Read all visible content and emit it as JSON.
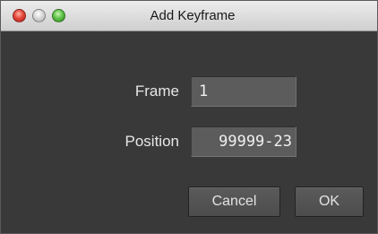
{
  "window": {
    "title": "Add Keyframe",
    "controls": {
      "close": "close-button",
      "minimize": "minimize-button",
      "zoom": "zoom-button"
    }
  },
  "form": {
    "frame_label": "Frame",
    "frame_value": "1",
    "position_label": "Position",
    "position_value": "99999-23"
  },
  "buttons": {
    "cancel": "Cancel",
    "ok": "OK"
  },
  "colors": {
    "close": "#e5463a",
    "minimize": "#d8d8d8",
    "zoom": "#5fc24a",
    "dialog_background": "#393939",
    "field_background": "#5c5c5c"
  }
}
